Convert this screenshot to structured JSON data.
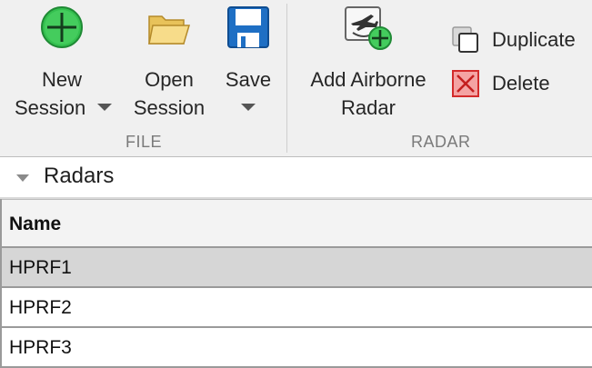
{
  "ribbon": {
    "groups": {
      "file_label": "FILE",
      "radar_label": "RADAR"
    },
    "new_session": {
      "line1": "New",
      "line2": "Session"
    },
    "open_session": {
      "line1": "Open",
      "line2": "Session"
    },
    "save": {
      "line1": "Save"
    },
    "add_airborne_radar": {
      "line1": "Add Airborne",
      "line2": "Radar"
    },
    "duplicate": {
      "label": "Duplicate"
    },
    "delete": {
      "label": "Delete"
    }
  },
  "section": {
    "title": "Radars"
  },
  "table": {
    "columns": [
      "Name"
    ],
    "rows": [
      {
        "name": "HPRF1",
        "selected": true
      },
      {
        "name": "HPRF2",
        "selected": false
      },
      {
        "name": "HPRF3",
        "selected": false
      }
    ]
  },
  "colors": {
    "new_icon": "#2fb84a",
    "delete_icon": "#e03a3a",
    "save_icon": "#1e6fc4",
    "selected_row": "#d6d6d6"
  }
}
